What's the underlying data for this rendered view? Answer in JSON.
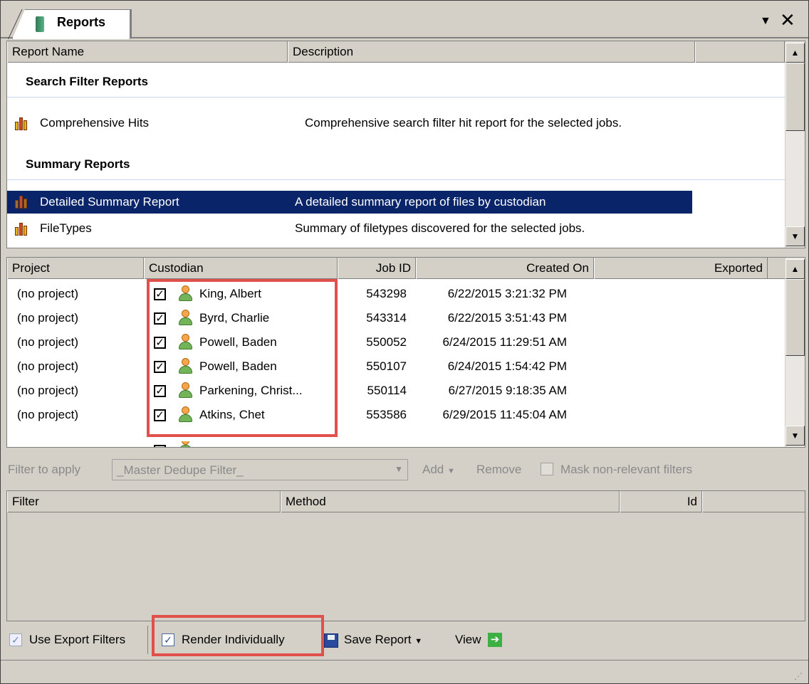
{
  "tab": {
    "title": "Reports"
  },
  "reports_table": {
    "columns": [
      "Report Name",
      "Description"
    ],
    "groups": [
      {
        "title": "Search Filter Reports",
        "items": [
          {
            "name": "Comprehensive Hits",
            "description": "Comprehensive search filter hit report for the selected jobs.",
            "selected": false
          }
        ]
      },
      {
        "title": "Summary Reports",
        "items": [
          {
            "name": "Detailed Summary Report",
            "description": "A detailed summary report of files by custodian",
            "selected": true
          },
          {
            "name": "FileTypes",
            "description": "Summary of filetypes discovered for the selected jobs.",
            "selected": false
          }
        ]
      }
    ]
  },
  "jobs_table": {
    "columns": [
      "Project",
      "Custodian",
      "Job ID",
      "Created On",
      "Exported"
    ],
    "rows": [
      {
        "project": "(no project)",
        "custodian": "King, Albert",
        "job_id": "543298",
        "created_on": "6/22/2015 3:21:32 PM",
        "checked": true
      },
      {
        "project": "(no project)",
        "custodian": "Byrd, Charlie",
        "job_id": "543314",
        "created_on": "6/22/2015 3:51:43 PM",
        "checked": true
      },
      {
        "project": "(no project)",
        "custodian": "Powell, Baden",
        "job_id": "550052",
        "created_on": "6/24/2015 11:29:51 AM",
        "checked": true
      },
      {
        "project": "(no project)",
        "custodian": "Powell, Baden",
        "job_id": "550107",
        "created_on": "6/24/2015 1:54:42 PM",
        "checked": true
      },
      {
        "project": "(no project)",
        "custodian": "Parkening, Christ...",
        "job_id": "550114",
        "created_on": "6/27/2015 9:18:35 AM",
        "checked": true
      },
      {
        "project": "(no project)",
        "custodian": "Atkins, Chet",
        "job_id": "553586",
        "created_on": "6/29/2015 11:45:04 AM",
        "checked": true
      }
    ]
  },
  "filter_bar": {
    "label": "Filter to apply",
    "selected_filter": "_Master Dedupe Filter_",
    "add_label": "Add",
    "remove_label": "Remove",
    "mask_label": "Mask non-relevant filters",
    "mask_checked": false
  },
  "filters_table": {
    "columns": [
      "Filter",
      "Method",
      "Id"
    ]
  },
  "toolbar": {
    "use_export_filters": {
      "label": "Use Export Filters",
      "checked": true
    },
    "render_individually": {
      "label": "Render Individually",
      "checked": true
    },
    "save_report_label": "Save Report",
    "view_label": "View"
  },
  "colors": {
    "selection": "#0a246a",
    "highlight_box": "#e2504c",
    "chrome": "#d4d0c8"
  }
}
